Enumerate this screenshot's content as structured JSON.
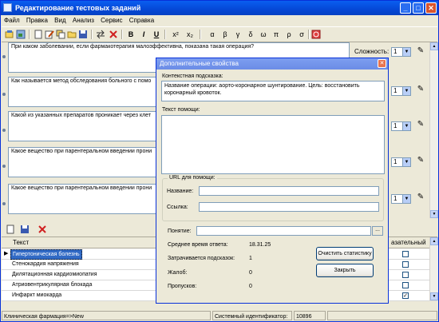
{
  "app": {
    "title": "Редактирование тестовых заданий",
    "window_controls": {
      "minimize": "_",
      "maximize": "□",
      "close": "✕"
    }
  },
  "menu": [
    "Файл",
    "Правка",
    "Вид",
    "Анализ",
    "Сервис",
    "Справка"
  ],
  "toolbar": {
    "bold": "B",
    "italic": "I",
    "underline": "U",
    "superscript": "x²",
    "subscript": "x₂",
    "greek": [
      "α",
      "β",
      "γ",
      "δ",
      "ω",
      "π",
      "ρ",
      "σ"
    ]
  },
  "questions": [
    {
      "text": "При каком заболевании, если фармакотерапия малоэффективна, показана такая операция?",
      "complexity_label": "Сложность:",
      "complexity_value": "1"
    },
    {
      "text": "Как называется метод обследования больного с помо",
      "complexity_label": "",
      "complexity_value": "1"
    },
    {
      "text": "Какой из указанных препаратов проникает через клет",
      "complexity_label": "",
      "complexity_value": "1"
    },
    {
      "text": "Какое вещество при парентеральном введении прони",
      "complexity_label": "",
      "complexity_value": "1"
    },
    {
      "text": "Какое вещество при парентеральном введении прони",
      "complexity_label": "",
      "complexity_value": "1"
    }
  ],
  "grid": {
    "columns": [
      "Текст",
      "азательный"
    ],
    "rows": [
      {
        "text": "Гипертоническая болезнь",
        "checked": false,
        "selected": true
      },
      {
        "text": "Стенокардия напряжения",
        "checked": false,
        "selected": false
      },
      {
        "text": "Дилятационная кардиомиопатия",
        "checked": false,
        "selected": false
      },
      {
        "text": "Атриовентрикулярная блокада",
        "checked": false,
        "selected": false
      },
      {
        "text": "Инфаркт миокарда",
        "checked": true,
        "selected": false
      }
    ],
    "current_row_marker": "▶"
  },
  "status_bar": {
    "path": "Клиническая фармация=>New",
    "system_id_label": "Системный идентификатор:",
    "system_id_value": "10896"
  },
  "dialog": {
    "title": "Дополнительные свойства",
    "context_hint_label": "Контекстная подсказка:",
    "context_hint_value": "Название операции: аорто-коронарное шунтирование. Цель: восстановить коронарный кровоток.",
    "help_text_label": "Текст помощи:",
    "url_group_label": "URL для помощи:",
    "name_label": "Название:",
    "link_label": "Ссылка:",
    "concept_label": "Понятие:",
    "concept_button": "...",
    "avg_time_label": "Среднее время ответа:",
    "avg_time_value": "18.31.25",
    "hints_used_label": "Затрачивается подсказок:",
    "hints_used_value": "1",
    "complaints_label": "Жалоб:",
    "complaints_value": "0",
    "skips_label": "Пропусков:",
    "skips_value": "0",
    "clear_stats_button": "Очистить статистику",
    "close_button": "Закрыть"
  },
  "colors": {
    "titlebar": "#0548d6",
    "dialog_titlebar": "#7d9ef0",
    "selection": "#316ac5",
    "window_bg": "#ece9d8"
  }
}
